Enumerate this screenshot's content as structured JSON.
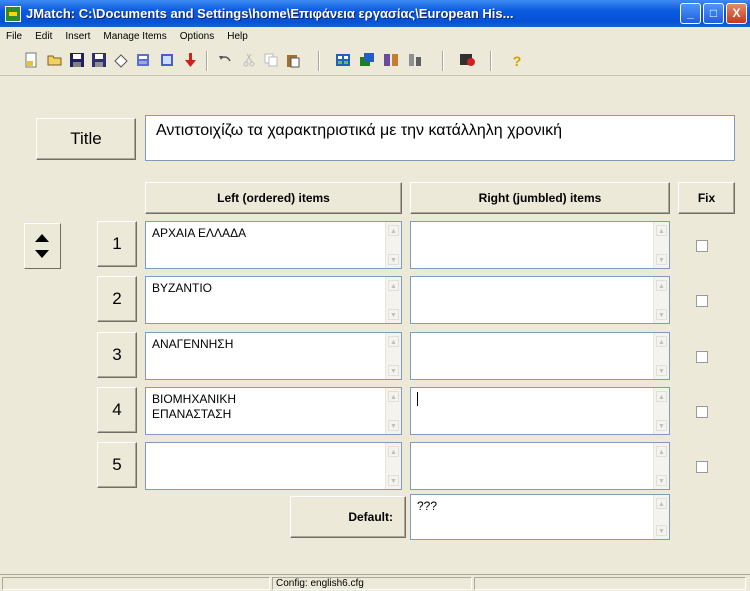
{
  "window": {
    "title": "JMatch: C:\\Documents and Settings\\home\\Επιφάνεια εργασίας\\European His...",
    "minimize": "_",
    "maximize": "□",
    "close": "X"
  },
  "menu": [
    "File",
    "Edit",
    "Insert",
    "Manage Items",
    "Options",
    "Help"
  ],
  "toolbar": {
    "help": "?"
  },
  "title_button": "Title",
  "title_value": "Αντιστοιχίζω τα χαρακτηριστικά με την κατάλληλη χρονική",
  "headers": {
    "left": "Left (ordered) items",
    "right": "Right (jumbled) items",
    "fix": "Fix"
  },
  "rows": [
    {
      "num": "1",
      "left": "ΑΡΧΑΙΑ ΕΛΛΑΔΑ",
      "left2": "",
      "right": ""
    },
    {
      "num": "2",
      "left": "ΒΥΖΑΝΤΙΟ",
      "left2": "",
      "right": ""
    },
    {
      "num": "3",
      "left": "ΑΝΑΓΕΝΝΗΣΗ",
      "left2": "",
      "right": ""
    },
    {
      "num": "4",
      "left": "ΒΙΟΜΗΧΑΝΙΚΗ",
      "left2": "ΕΠΑΝΑΣΤΑΣΗ",
      "right": ""
    },
    {
      "num": "5",
      "left": "",
      "left2": "",
      "right": ""
    }
  ],
  "default_label": "Default:",
  "default_value": "???",
  "status": "Config: english6.cfg"
}
